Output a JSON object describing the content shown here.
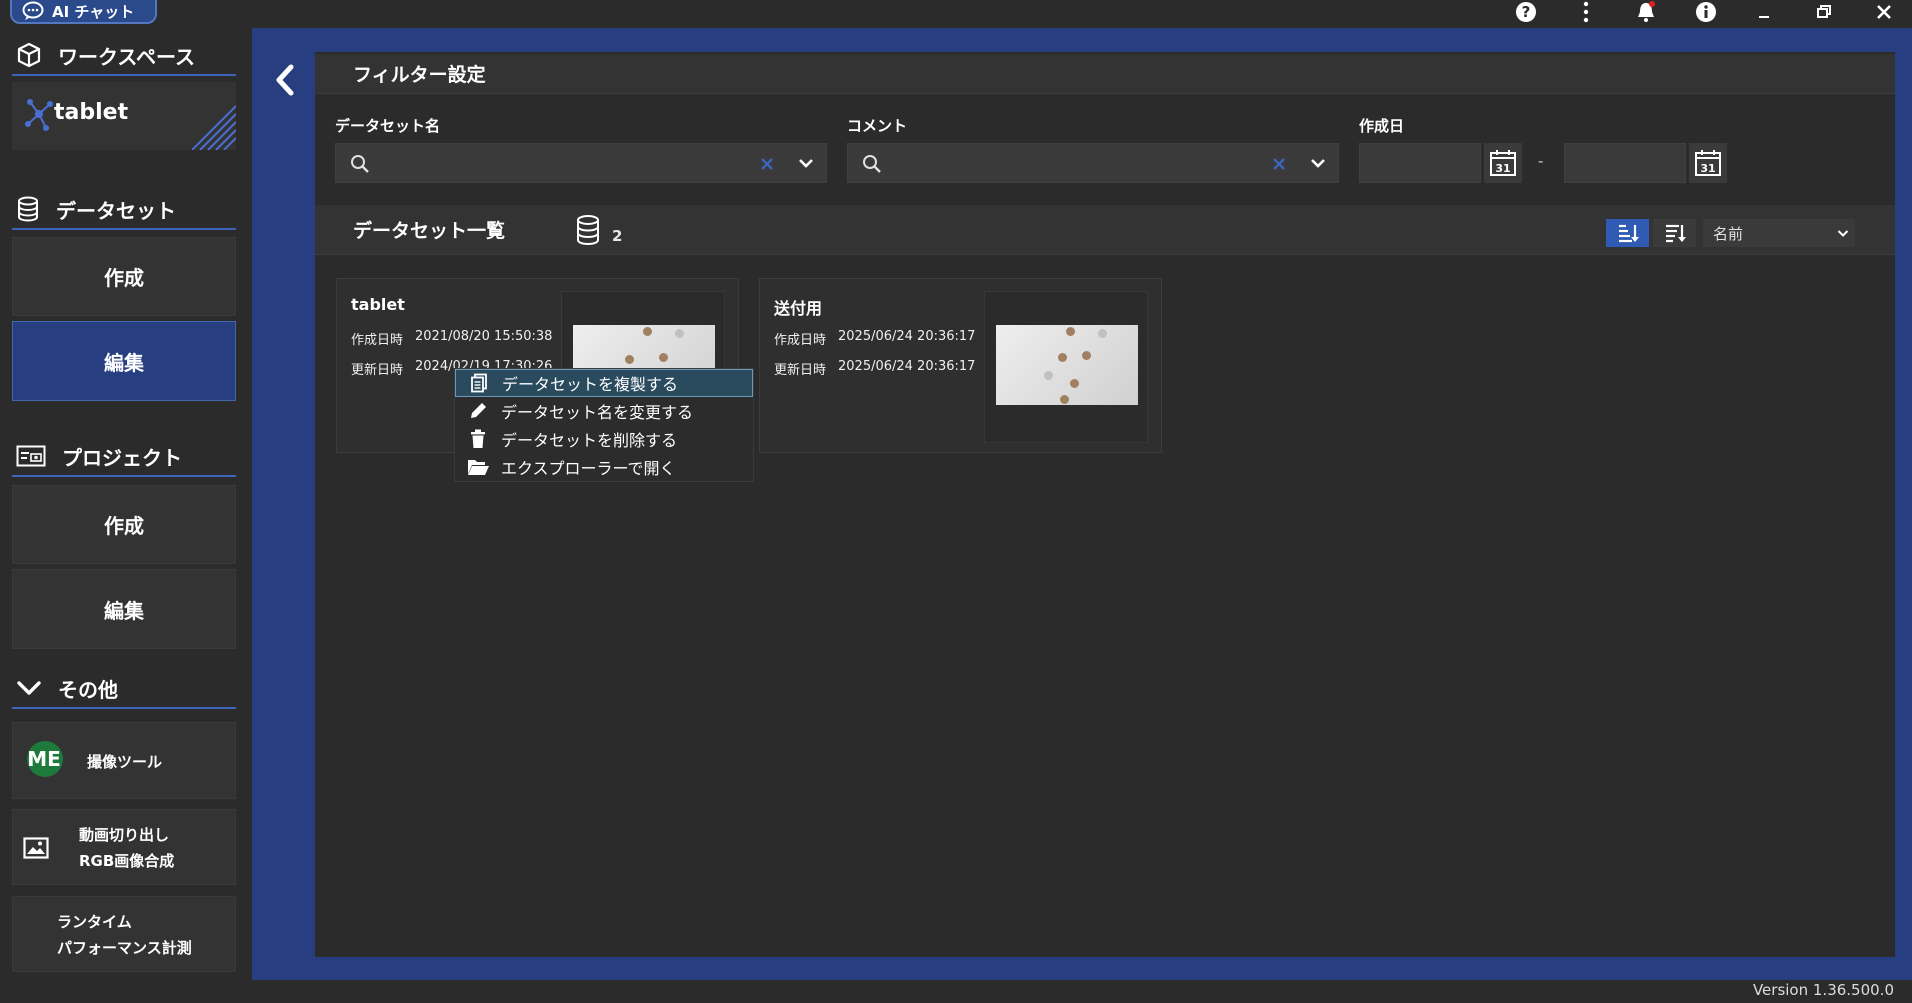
{
  "topbar": {
    "ai_chat_label": "AI チャット",
    "icons": [
      "help-icon",
      "more-vert-icon",
      "bell-icon",
      "info-icon",
      "minimize-icon",
      "restore-icon",
      "close-icon"
    ]
  },
  "sidebar": {
    "workspace": {
      "label": "ワークスペース",
      "name": "tablet"
    },
    "dataset": {
      "label": "データセット",
      "create": "作成",
      "edit": "編集"
    },
    "project": {
      "label": "プロジェクト",
      "create": "作成",
      "edit": "編集"
    },
    "other": {
      "label": "その他"
    },
    "tools": [
      {
        "label": "撮像ツール",
        "badge": "ME"
      },
      {
        "line1": "動画切り出し",
        "line2": "RGB画像合成"
      },
      {
        "line1": "ランタイム",
        "line2": "パフォーマンス計測"
      }
    ]
  },
  "filter": {
    "title": "フィルター設定",
    "dataset_name_label": "データセット名",
    "dataset_name_value": "",
    "comment_label": "コメント",
    "comment_value": "",
    "created_label": "作成日",
    "date_from": "",
    "date_to": "",
    "date_sep": "-",
    "calendar_day": "31"
  },
  "list": {
    "title": "データセット一覧",
    "count": "2",
    "sort_field": "名前",
    "datasets": [
      {
        "name": "tablet",
        "created_label": "作成日時",
        "created": "2021/08/20 15:50:38",
        "updated_label": "更新日時",
        "updated": "2024/02/19 17:30:26"
      },
      {
        "name": "送付用",
        "created_label": "作成日時",
        "created": "2025/06/24 20:36:17",
        "updated_label": "更新日時",
        "updated": "2025/06/24 20:36:17"
      }
    ]
  },
  "context_menu": {
    "items": [
      {
        "label": "データセットを複製する",
        "icon": "copy-icon"
      },
      {
        "label": "データセット名を変更する",
        "icon": "pencil-icon"
      },
      {
        "label": "データセットを削除する",
        "icon": "trash-icon"
      },
      {
        "label": "エクスプローラーで開く",
        "icon": "folder-open-icon"
      }
    ]
  },
  "footer": {
    "version": "Version 1.36.500.0"
  },
  "colors": {
    "accent": "#273e80",
    "panel": "#2b2b2b",
    "clear_x": "#3d64b8"
  }
}
